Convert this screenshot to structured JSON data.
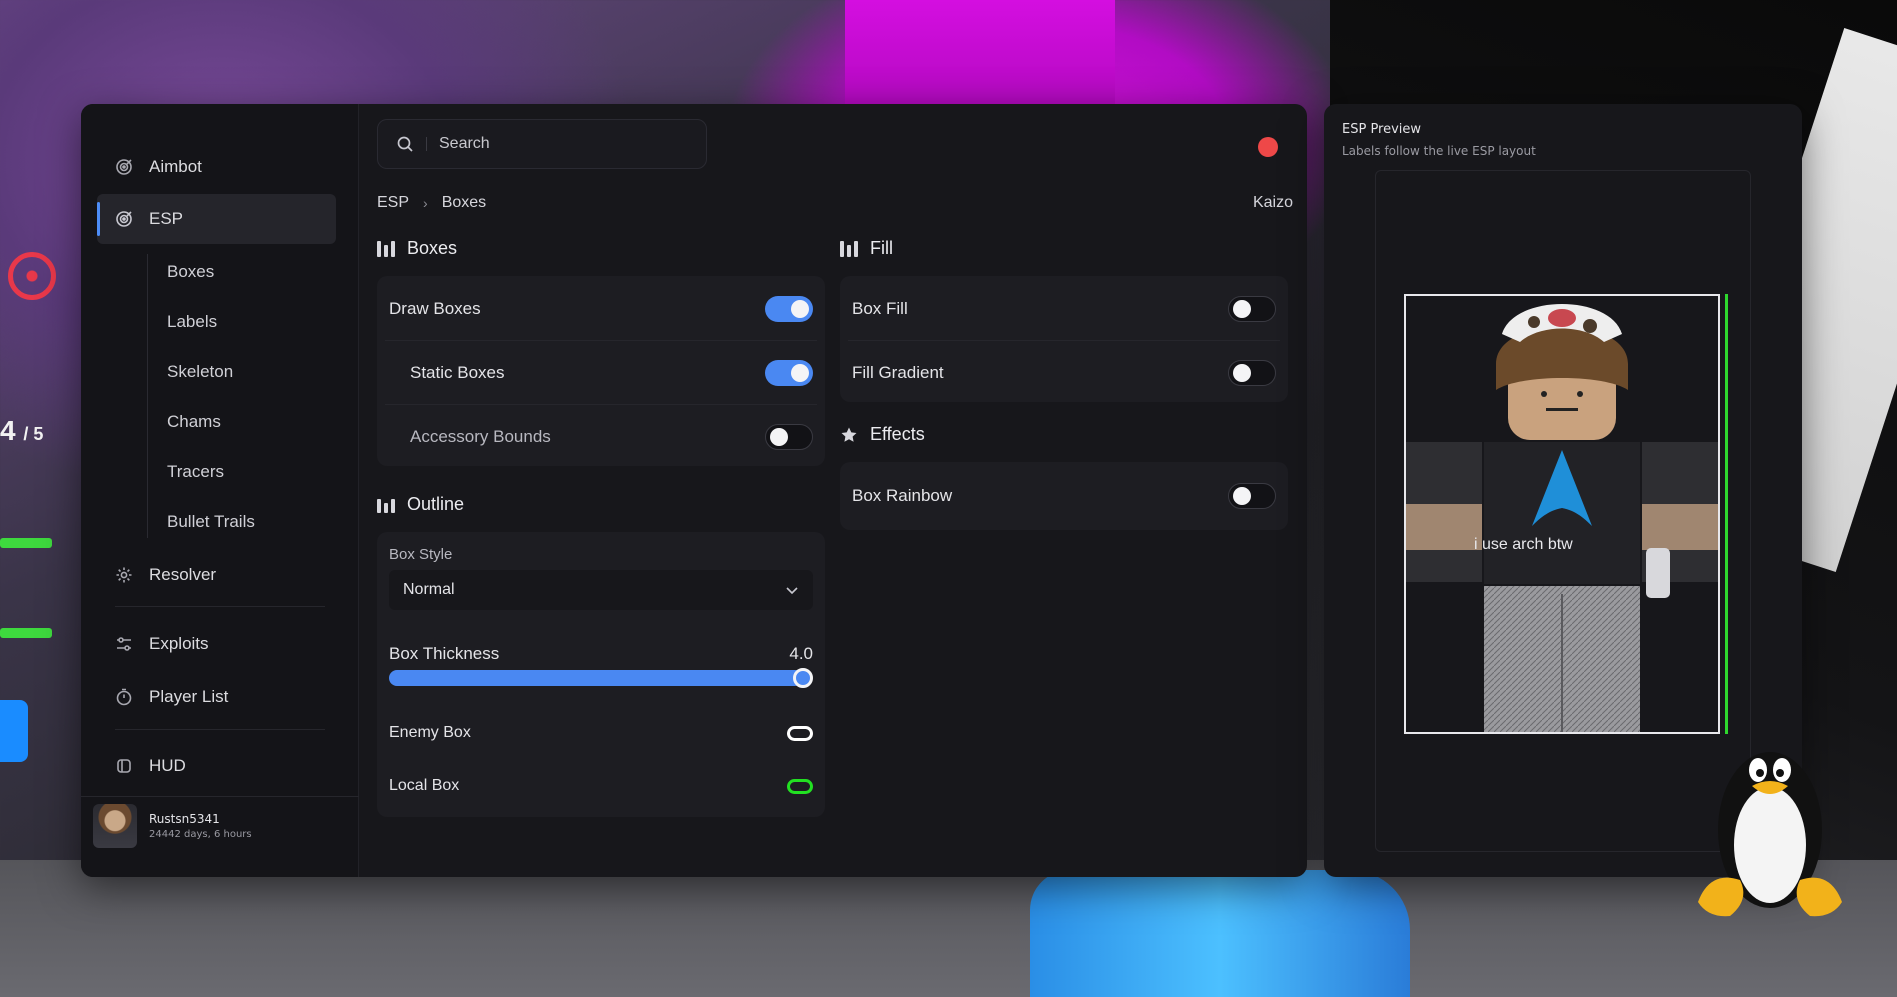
{
  "background": {
    "hud_score": "4",
    "hud_score_total": "/ 5"
  },
  "sidebar": {
    "items": [
      {
        "label": "Aimbot",
        "icon": "target-icon"
      },
      {
        "label": "ESP",
        "icon": "target-icon",
        "active": true
      },
      {
        "label": "Resolver",
        "icon": "gear-icon"
      },
      {
        "label": "Exploits",
        "icon": "sliders-icon"
      },
      {
        "label": "Player List",
        "icon": "timer-icon"
      },
      {
        "label": "HUD",
        "icon": "layers-icon"
      }
    ],
    "esp_subitems": [
      "Boxes",
      "Labels",
      "Skeleton",
      "Chams",
      "Tracers",
      "Bullet Trails"
    ]
  },
  "user": {
    "name": "Rustsn5341",
    "time": "24442 days, 6 hours"
  },
  "search": {
    "placeholder": "Search"
  },
  "breadcrumb": [
    "ESP",
    "Boxes"
  ],
  "user_tag": "Kaizo",
  "sections": {
    "boxes": {
      "title": "Boxes",
      "rows": [
        {
          "label": "Draw Boxes",
          "on": true
        },
        {
          "label": "Static Boxes",
          "on": true
        },
        {
          "label": "Accessory Bounds",
          "on": false
        }
      ]
    },
    "outline": {
      "title": "Outline",
      "box_style_label": "Box Style",
      "box_style_value": "Normal",
      "thickness_label": "Box Thickness",
      "thickness_value": "4.0",
      "thickness_fraction": 1.0,
      "enemy_box_label": "Enemy Box",
      "enemy_box_color": "#ffffff",
      "local_box_label": "Local Box",
      "local_box_color": "#22e022"
    },
    "fill": {
      "title": "Fill",
      "rows": [
        {
          "label": "Box Fill",
          "on": false
        },
        {
          "label": "Fill Gradient",
          "on": false
        }
      ]
    },
    "effects": {
      "title": "Effects",
      "rows": [
        {
          "label": "Box Rainbow",
          "on": false
        }
      ]
    }
  },
  "preview": {
    "title": "ESP Preview",
    "subtitle": "Labels follow the live ESP layout",
    "shirt_text": "i use arch btw"
  },
  "colors": {
    "accent": "#4a88f2",
    "close": "#ee4848",
    "health": "#2ed72e"
  }
}
